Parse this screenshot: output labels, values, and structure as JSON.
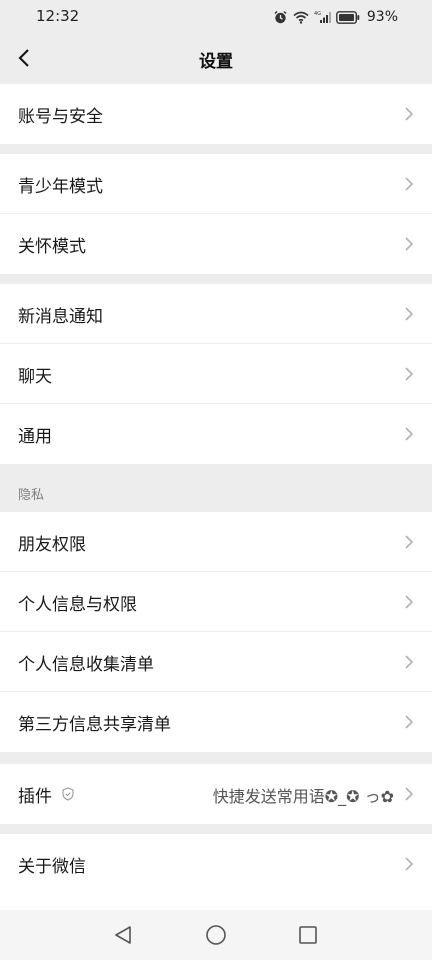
{
  "status_bar": {
    "time": "12:32",
    "battery_percent": "93%",
    "icons": [
      "alarm-icon",
      "wifi-icon",
      "signal-icon",
      "battery-icon"
    ]
  },
  "header": {
    "title": "设置"
  },
  "groups": [
    {
      "items": [
        {
          "label": "账号与安全"
        }
      ]
    },
    {
      "items": [
        {
          "label": "青少年模式"
        },
        {
          "label": "关怀模式"
        }
      ]
    },
    {
      "items": [
        {
          "label": "新消息通知"
        },
        {
          "label": "聊天"
        },
        {
          "label": "通用"
        }
      ]
    },
    {
      "section_label": "隐私",
      "items": [
        {
          "label": "朋友权限"
        },
        {
          "label": "个人信息与权限"
        },
        {
          "label": "个人信息收集清单"
        },
        {
          "label": "第三方信息共享清单"
        }
      ]
    },
    {
      "items": [
        {
          "label": "插件",
          "value": "快捷发送常用语✪_✪ っ✿"
        }
      ]
    },
    {
      "items": [
        {
          "label": "关于微信"
        }
      ]
    }
  ],
  "bottom_nav": {
    "icons": [
      "back-triangle-icon",
      "home-circle-icon",
      "recents-square-icon"
    ]
  },
  "colors": {
    "background": "#ededed",
    "card": "#ffffff",
    "text": "#191919",
    "secondary_text": "#7f7f7f"
  }
}
